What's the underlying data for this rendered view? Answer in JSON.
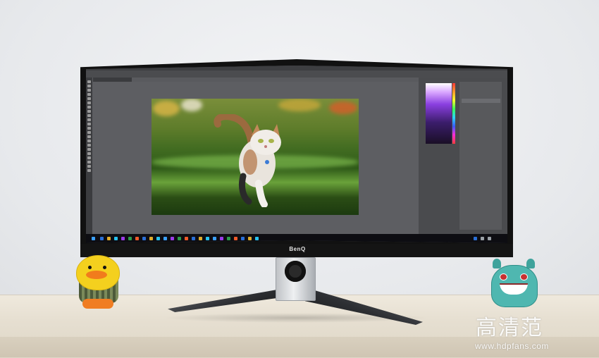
{
  "monitor": {
    "brand": "BenQ"
  },
  "watermark": {
    "logo_text": "高清范",
    "url": "www.hdpfans.com"
  }
}
